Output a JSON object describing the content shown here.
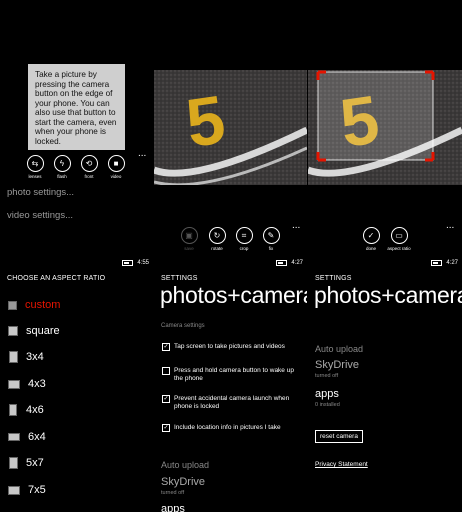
{
  "p1": {
    "tooltip": "Take a picture by pressing the camera button on the edge of your phone. You can also use that button to start the camera, even when your phone is locked.",
    "buttons": [
      {
        "label": "lenses",
        "glyph": "⇆"
      },
      {
        "label": "flash",
        "glyph": "ϟ"
      },
      {
        "label": "front",
        "glyph": "⟲"
      },
      {
        "label": "video",
        "glyph": "■"
      }
    ],
    "menu": [
      "photo settings...",
      "video settings..."
    ],
    "more": "..."
  },
  "p2": {
    "buttons": [
      {
        "label": "save",
        "glyph": "▣"
      },
      {
        "label": "rotate",
        "glyph": "↻"
      },
      {
        "label": "crop",
        "glyph": "⌗"
      },
      {
        "label": "fix",
        "glyph": "✎"
      }
    ],
    "more": "...",
    "photo_number": "5"
  },
  "p3": {
    "buttons": [
      {
        "label": "done",
        "glyph": "✓"
      },
      {
        "label": "aspect ratio",
        "glyph": "▭"
      }
    ],
    "more": "...",
    "photo_number": "5"
  },
  "p4": {
    "time": "4:55",
    "heading": "CHOOSE AN ASPECT RATIO",
    "options": [
      "custom",
      "square",
      "3x4",
      "4x3",
      "4x6",
      "6x4",
      "5x7",
      "7x5"
    ],
    "selected_color": "#e51400"
  },
  "p5": {
    "time": "4:27",
    "app_title": "SETTINGS",
    "page_title": "photos+camera",
    "section": "Camera settings",
    "checkboxes": [
      {
        "label": "Tap screen to take pictures and videos",
        "checked": true
      },
      {
        "label": "Press and hold camera button to wake up the phone",
        "checked": false
      },
      {
        "label": "Prevent accidental camera launch when phone is locked",
        "checked": true
      },
      {
        "label": "Include location info in pictures I take",
        "checked": true
      }
    ],
    "auto_upload": "Auto upload",
    "skydrive": "SkyDrive",
    "skydrive_status": "turned off",
    "apps_partial": "apps"
  },
  "p6": {
    "time": "4:27",
    "app_title": "SETTINGS",
    "page_title": "photos+camera",
    "auto_upload": "Auto upload",
    "skydrive": "SkyDrive",
    "skydrive_status": "turned off",
    "apps": "apps",
    "apps_status": "0 installed",
    "reset_button": "reset camera",
    "privacy_link": "Privacy Statement"
  }
}
